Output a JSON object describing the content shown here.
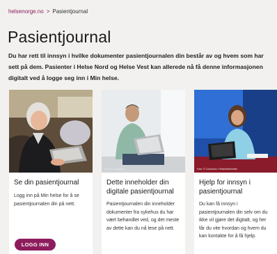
{
  "breadcrumb": {
    "home": "helsenorge.no",
    "separator": ">",
    "current": "Pasientjournal"
  },
  "page": {
    "title": "Pasientjournal",
    "intro": "Du har rett til innsyn i hvilke dokumenter pasientjournalen din består av og hvem som har sett på dem. Pasienter i Helse Nord og Helse Vest kan allerede nå få denne informasjonen digitalt ved å logge seg inn i Min helse."
  },
  "cards": [
    {
      "title": "Se din pasientjournal",
      "body": "Logg inn på Min helse for å se pasientjournalen din på nett.",
      "button": "LOGG INN"
    },
    {
      "title": "Dette inneholder din digitale pasientjournal",
      "body": "Pasientjournalen din inneholder dokumenter fra sykehus du har vært behandlet ved, og det meste av dette kan du nå lese på nett.",
      "credit": "Foto: © Colourbox"
    },
    {
      "title": "Hjelp for innsyn i pasientjournal",
      "body": "Du kan få innsyn i pasientjournalen din selv om du ikke vil gjøre det digitalt, og her får du vite hvordan og hvem du kan kontakte for å få hjelp.",
      "credit": "Foto: © Colourbox / Helsedirektoratet"
    }
  ],
  "colors": {
    "accent": "#8d1c5c",
    "background": "#f2f1ef",
    "card": "#ffffff"
  }
}
